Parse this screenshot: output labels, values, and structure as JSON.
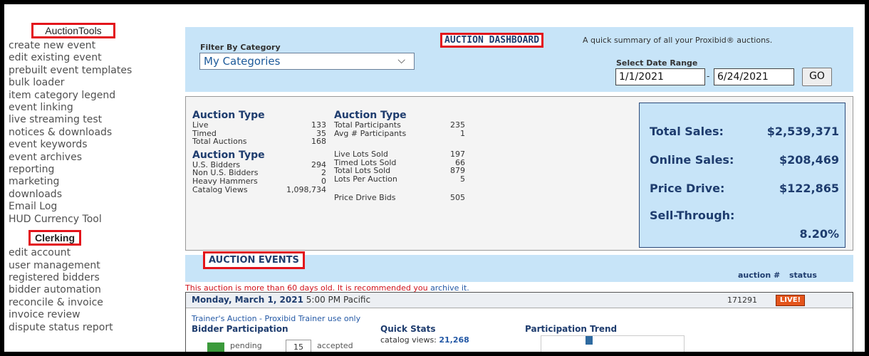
{
  "sidebar": {
    "auction_tools_heading": "AuctionTools",
    "auction_tools": [
      "create new event",
      "edit existing event",
      "prebuilt event templates",
      "bulk loader",
      "item category legend",
      "event linking",
      "live streaming test",
      "notices & downloads",
      "event keywords",
      "event archives",
      "reporting",
      "marketing",
      "downloads",
      "Email Log",
      "HUD Currency Tool"
    ],
    "clerking_heading": "Clerking",
    "clerking": [
      "edit account",
      "user management",
      "registered bidders",
      "bidder automation",
      "reconcile & invoice",
      "invoice review",
      "dispute status report"
    ]
  },
  "filter": {
    "label": "Filter By Category",
    "selected": "My Categories"
  },
  "dashboard": {
    "title": "AUCTION DASHBOARD",
    "description": "A quick summary of all your Proxibid® auctions."
  },
  "date_range": {
    "label": "Select Date Range",
    "from": "1/1/2021",
    "separator": "-",
    "to": "6/24/2021",
    "go_label": "GO"
  },
  "summary": {
    "col1": {
      "heading": "Auction Type",
      "rows": [
        {
          "label": "Live",
          "value": "133"
        },
        {
          "label": "Timed",
          "value": "35"
        },
        {
          "label": "Total Auctions",
          "value": "168"
        }
      ]
    },
    "col2": {
      "heading": "Auction Type",
      "rows": [
        {
          "label": "U.S. Bidders",
          "value": "294"
        },
        {
          "label": "Non U.S. Bidders",
          "value": "2"
        },
        {
          "label": "Heavy Hammers",
          "value": "0"
        },
        {
          "label": "Catalog Views",
          "value": "1,098,734"
        }
      ]
    },
    "col3": {
      "heading": "Auction Type",
      "rows": [
        {
          "label": "Total Participants",
          "value": "235"
        },
        {
          "label": "Avg # Participants",
          "value": "1"
        }
      ]
    },
    "col4": {
      "rows": [
        {
          "label": "Live Lots Sold",
          "value": "197"
        },
        {
          "label": "Timed Lots Sold",
          "value": "66"
        },
        {
          "label": "Total Lots Sold",
          "value": "879"
        },
        {
          "label": "Lots Per Auction",
          "value": "5"
        }
      ]
    },
    "price_drive_bids": {
      "label": "Price Drive Bids",
      "value": "505"
    }
  },
  "totals": {
    "total_sales_label": "Total Sales:",
    "total_sales": "$2,539,371",
    "online_sales_label": "Online Sales:",
    "online_sales": "$208,469",
    "price_drive_label": "Price Drive:",
    "price_drive": "$122,865",
    "sell_through_label": "Sell-Through:",
    "sell_through": "8.20%"
  },
  "events": {
    "title": "AUCTION EVENTS",
    "col_auction": "auction #",
    "col_status": "status",
    "warning_text": "This auction is more than 60 days old. It is recommended you ",
    "warning_link": "archive it.",
    "event": {
      "date": "Monday, March 1, 2021",
      "time": "5:00 PM Pacific",
      "auction_number": "171291",
      "status": "LIVE!",
      "name": "Trainer's Auction - Proxibid Trainer use only",
      "bidder_participation": "Bidder Participation",
      "quick_stats": "Quick Stats",
      "participation_trend": "Participation Trend",
      "catalog_views_label": "catalog views:",
      "catalog_views": "21,268",
      "pending_label": "pending",
      "accepted_count": "15",
      "accepted_label": "accepted"
    }
  },
  "colors": {
    "highlight": "#e3141b",
    "panel_blue": "#c7e4f8",
    "heading_navy": "#1e3c6e",
    "live_badge": "#e4551c"
  }
}
